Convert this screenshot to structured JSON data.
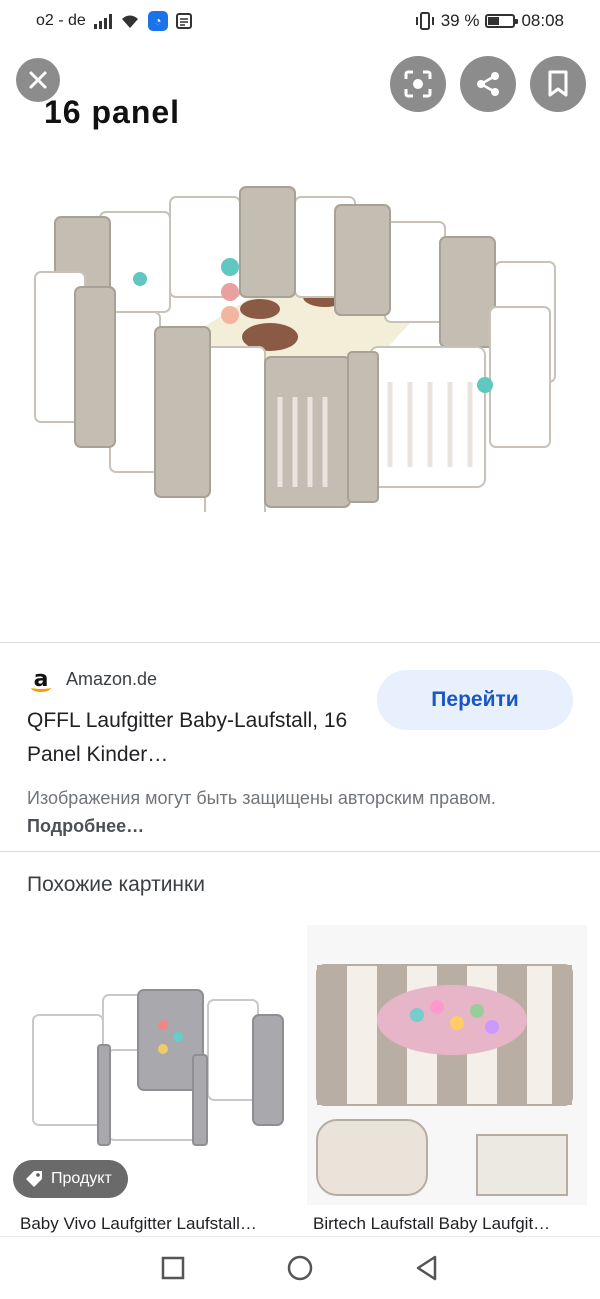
{
  "status_bar": {
    "carrier": "o2 - de",
    "battery_percent": "39 %",
    "battery_level": 0.39,
    "time": "08:08"
  },
  "image_viewer": {
    "overlay_text": "16 panel",
    "icons": [
      "close-icon",
      "lens-icon",
      "share-icon",
      "bookmark-icon"
    ]
  },
  "result": {
    "source": "Amazon.de",
    "title": "QFFL Laufgitter Baby-Laufstall, 16 Panel Kinder…",
    "go_label": "Перейти",
    "copyright_text": "Изображения могут быть защищены авторским правом.",
    "more_link": "Подробнее…"
  },
  "similar": {
    "heading": "Похожие картинки",
    "items": [
      {
        "caption": "Baby Vivo Laufgitter Laufstall…",
        "chip": "Продукт"
      },
      {
        "caption": "Birtech Laufstall Baby Laufgit…"
      }
    ]
  },
  "colors": {
    "accent": "#1a73e8",
    "go_button_bg": "#e8f0fe",
    "amazon_orange": "#ff9900"
  }
}
